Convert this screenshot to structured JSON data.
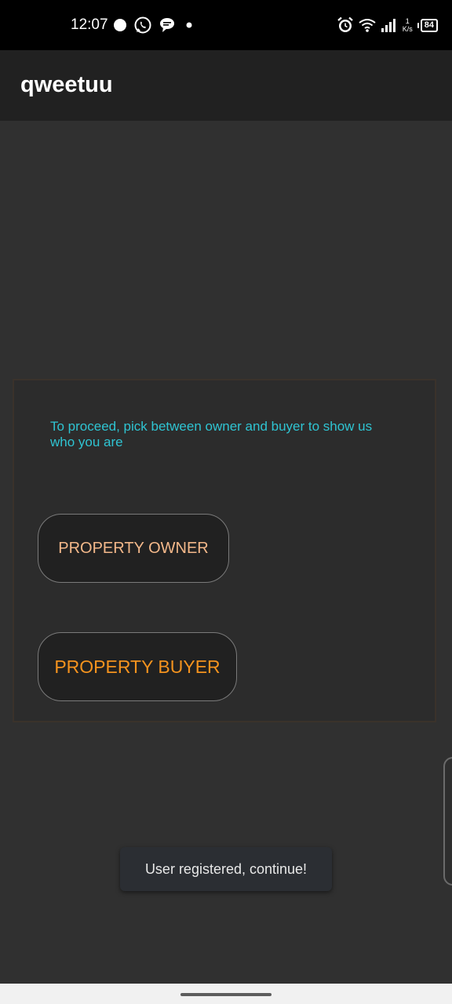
{
  "status_bar": {
    "time": "12:07",
    "left_icons": [
      "circle-notification-icon",
      "whatsapp-icon",
      "chat-bubble-icon",
      "dot-icon"
    ],
    "net_speed_value": "1",
    "net_speed_unit": "K/s",
    "battery": "84"
  },
  "app_bar": {
    "title": "qweetuu"
  },
  "card": {
    "prompt": "To proceed, pick between owner and buyer to show us who you are",
    "owner_button": "PROPERTY OWNER",
    "buyer_button": "PROPERTY BUYER"
  },
  "toast": {
    "message": "User registered, continue!"
  },
  "colors": {
    "background": "#303030",
    "app_bar": "#212121",
    "prompt_text": "#2fc4d2",
    "owner_text": "#f3b88a",
    "buyer_text": "#f5931e"
  }
}
